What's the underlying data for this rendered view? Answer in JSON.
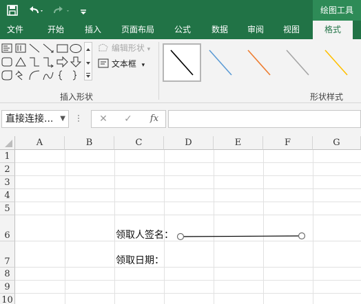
{
  "qat": {
    "save_icon": "save-icon",
    "undo_icon": "undo-icon",
    "redo_icon": "redo-icon",
    "customize_icon": "customize-qat-icon",
    "contextual_tab_group": "绘图工具"
  },
  "tabs": [
    {
      "label": "文件"
    },
    {
      "label": "开始"
    },
    {
      "label": "插入"
    },
    {
      "label": "页面布局"
    },
    {
      "label": "公式"
    },
    {
      "label": "数据"
    },
    {
      "label": "审阅"
    },
    {
      "label": "视图"
    },
    {
      "label": "格式",
      "active": true
    }
  ],
  "ribbon": {
    "insert_shapes": {
      "group_label": "插入形状",
      "edit_shape_label": "编辑形状",
      "text_box_label": "文本框"
    },
    "shape_styles": {
      "group_label": "形状样式",
      "swatch_colors": [
        "#000000",
        "#5b9bd5",
        "#ed7d31",
        "#a5a5a5",
        "#ffc000"
      ]
    }
  },
  "formula_bar": {
    "name_box": "直接连接...",
    "cancel_label": "✕",
    "enter_label": "✓",
    "fx_label": "fx",
    "formula": ""
  },
  "sheet": {
    "columns": [
      "A",
      "B",
      "C",
      "D",
      "E",
      "F",
      "G"
    ],
    "rows": [
      "1",
      "2",
      "3",
      "4",
      "5",
      "6",
      "7",
      "8",
      "9",
      "10"
    ],
    "cells": {
      "C6": "领取人签名：",
      "C7": "领取日期："
    },
    "selected_shape": "straight-connector"
  }
}
